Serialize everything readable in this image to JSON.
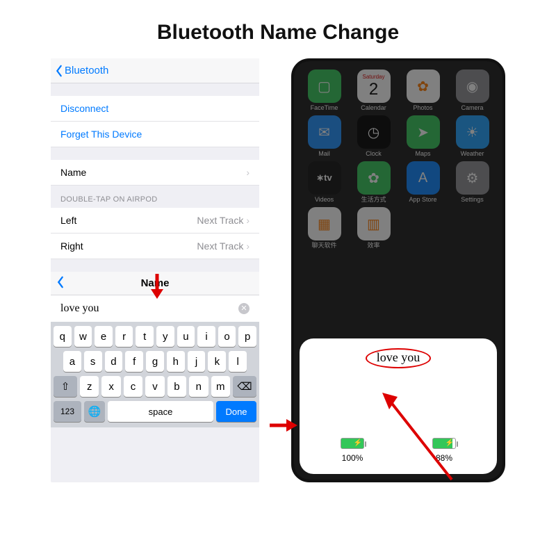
{
  "banner": {
    "title": "Bluetooth Name Change"
  },
  "settings": {
    "back_label": "Bluetooth",
    "disconnect": "Disconnect",
    "forget": "Forget This Device",
    "name_row": {
      "label": "Name"
    },
    "section_header": "DOUBLE-TAP ON AIRPOD",
    "left": {
      "label": "Left",
      "value": "Next Track"
    },
    "right": {
      "label": "Right",
      "value": "Next Track"
    }
  },
  "name_editor": {
    "title": "Name",
    "value": "love you"
  },
  "keyboard": {
    "row1": [
      "q",
      "w",
      "e",
      "r",
      "t",
      "y",
      "u",
      "i",
      "o",
      "p"
    ],
    "row2": [
      "a",
      "s",
      "d",
      "f",
      "g",
      "h",
      "j",
      "k",
      "l"
    ],
    "row3_mid": [
      "z",
      "x",
      "c",
      "v",
      "b",
      "n",
      "m"
    ],
    "num_label": "123",
    "space_label": "space",
    "done_label": "Done"
  },
  "homescreen": {
    "calendar_day": "Saturday",
    "calendar_date": "2",
    "apps": [
      {
        "label": "FaceTime",
        "bg": "#33c759",
        "glyph": "▢"
      },
      {
        "label": "Calendar",
        "bg": "#ffffff",
        "glyph": ""
      },
      {
        "label": "Photos",
        "bg": "#ffffff",
        "glyph": "✿"
      },
      {
        "label": "Camera",
        "bg": "#8e8e93",
        "glyph": "◉"
      },
      {
        "label": "Mail",
        "bg": "#1e90ff",
        "glyph": "✉"
      },
      {
        "label": "Clock",
        "bg": "#000000",
        "glyph": "◷"
      },
      {
        "label": "Maps",
        "bg": "#34c759",
        "glyph": "➤"
      },
      {
        "label": "Weather",
        "bg": "#1ea0ff",
        "glyph": "☀"
      },
      {
        "label": "Videos",
        "bg": "#101010",
        "glyph": "tv"
      },
      {
        "label": "生活方式",
        "bg": "#34c759",
        "glyph": "✿"
      },
      {
        "label": "App Store",
        "bg": "#0a84ff",
        "glyph": "A"
      },
      {
        "label": "Settings",
        "bg": "#8e8e93",
        "glyph": "⚙"
      },
      {
        "label": "聊天软件",
        "bg": "#ffffff",
        "glyph": "▦"
      },
      {
        "label": "效率",
        "bg": "#ffffff",
        "glyph": "▥"
      }
    ]
  },
  "popup": {
    "device_name": "love you",
    "batteries": [
      {
        "percent_label": "100%",
        "fill": 100
      },
      {
        "percent_label": "88%",
        "fill": 88
      }
    ]
  }
}
